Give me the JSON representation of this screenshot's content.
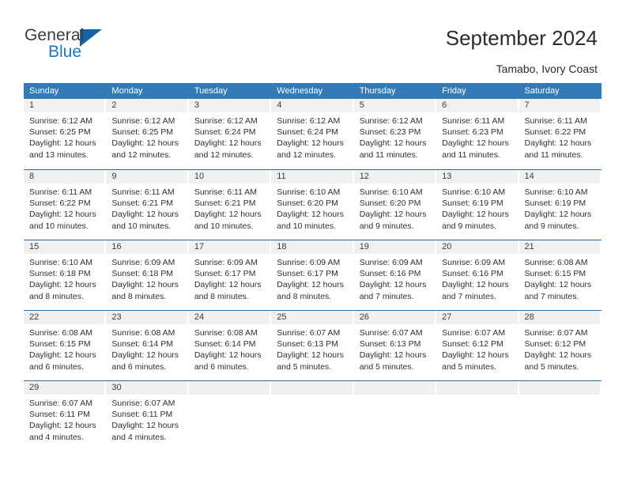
{
  "brand": {
    "name_top": "General",
    "name_bottom": "Blue",
    "color_dark": "#3b3b3b",
    "color_blue": "#1c78c0",
    "triangle_color": "#1464a5"
  },
  "header": {
    "title": "September 2024",
    "subtitle": "Tamabo, Ivory Coast"
  },
  "theme": {
    "header_bar": "#337ab7",
    "row_divider": "#2f6fa8",
    "day_head_bg": "#f0f0f0",
    "text": "#2f2f2f"
  },
  "weekdays": [
    "Sunday",
    "Monday",
    "Tuesday",
    "Wednesday",
    "Thursday",
    "Friday",
    "Saturday"
  ],
  "weeks": [
    [
      {
        "day": "1",
        "sunrise": "Sunrise: 6:12 AM",
        "sunset": "Sunset: 6:25 PM",
        "daylight1": "Daylight: 12 hours",
        "daylight2": "and 13 minutes."
      },
      {
        "day": "2",
        "sunrise": "Sunrise: 6:12 AM",
        "sunset": "Sunset: 6:25 PM",
        "daylight1": "Daylight: 12 hours",
        "daylight2": "and 12 minutes."
      },
      {
        "day": "3",
        "sunrise": "Sunrise: 6:12 AM",
        "sunset": "Sunset: 6:24 PM",
        "daylight1": "Daylight: 12 hours",
        "daylight2": "and 12 minutes."
      },
      {
        "day": "4",
        "sunrise": "Sunrise: 6:12 AM",
        "sunset": "Sunset: 6:24 PM",
        "daylight1": "Daylight: 12 hours",
        "daylight2": "and 12 minutes."
      },
      {
        "day": "5",
        "sunrise": "Sunrise: 6:12 AM",
        "sunset": "Sunset: 6:23 PM",
        "daylight1": "Daylight: 12 hours",
        "daylight2": "and 11 minutes."
      },
      {
        "day": "6",
        "sunrise": "Sunrise: 6:11 AM",
        "sunset": "Sunset: 6:23 PM",
        "daylight1": "Daylight: 12 hours",
        "daylight2": "and 11 minutes."
      },
      {
        "day": "7",
        "sunrise": "Sunrise: 6:11 AM",
        "sunset": "Sunset: 6:22 PM",
        "daylight1": "Daylight: 12 hours",
        "daylight2": "and 11 minutes."
      }
    ],
    [
      {
        "day": "8",
        "sunrise": "Sunrise: 6:11 AM",
        "sunset": "Sunset: 6:22 PM",
        "daylight1": "Daylight: 12 hours",
        "daylight2": "and 10 minutes."
      },
      {
        "day": "9",
        "sunrise": "Sunrise: 6:11 AM",
        "sunset": "Sunset: 6:21 PM",
        "daylight1": "Daylight: 12 hours",
        "daylight2": "and 10 minutes."
      },
      {
        "day": "10",
        "sunrise": "Sunrise: 6:11 AM",
        "sunset": "Sunset: 6:21 PM",
        "daylight1": "Daylight: 12 hours",
        "daylight2": "and 10 minutes."
      },
      {
        "day": "11",
        "sunrise": "Sunrise: 6:10 AM",
        "sunset": "Sunset: 6:20 PM",
        "daylight1": "Daylight: 12 hours",
        "daylight2": "and 10 minutes."
      },
      {
        "day": "12",
        "sunrise": "Sunrise: 6:10 AM",
        "sunset": "Sunset: 6:20 PM",
        "daylight1": "Daylight: 12 hours",
        "daylight2": "and 9 minutes."
      },
      {
        "day": "13",
        "sunrise": "Sunrise: 6:10 AM",
        "sunset": "Sunset: 6:19 PM",
        "daylight1": "Daylight: 12 hours",
        "daylight2": "and 9 minutes."
      },
      {
        "day": "14",
        "sunrise": "Sunrise: 6:10 AM",
        "sunset": "Sunset: 6:19 PM",
        "daylight1": "Daylight: 12 hours",
        "daylight2": "and 9 minutes."
      }
    ],
    [
      {
        "day": "15",
        "sunrise": "Sunrise: 6:10 AM",
        "sunset": "Sunset: 6:18 PM",
        "daylight1": "Daylight: 12 hours",
        "daylight2": "and 8 minutes."
      },
      {
        "day": "16",
        "sunrise": "Sunrise: 6:09 AM",
        "sunset": "Sunset: 6:18 PM",
        "daylight1": "Daylight: 12 hours",
        "daylight2": "and 8 minutes."
      },
      {
        "day": "17",
        "sunrise": "Sunrise: 6:09 AM",
        "sunset": "Sunset: 6:17 PM",
        "daylight1": "Daylight: 12 hours",
        "daylight2": "and 8 minutes."
      },
      {
        "day": "18",
        "sunrise": "Sunrise: 6:09 AM",
        "sunset": "Sunset: 6:17 PM",
        "daylight1": "Daylight: 12 hours",
        "daylight2": "and 8 minutes."
      },
      {
        "day": "19",
        "sunrise": "Sunrise: 6:09 AM",
        "sunset": "Sunset: 6:16 PM",
        "daylight1": "Daylight: 12 hours",
        "daylight2": "and 7 minutes."
      },
      {
        "day": "20",
        "sunrise": "Sunrise: 6:09 AM",
        "sunset": "Sunset: 6:16 PM",
        "daylight1": "Daylight: 12 hours",
        "daylight2": "and 7 minutes."
      },
      {
        "day": "21",
        "sunrise": "Sunrise: 6:08 AM",
        "sunset": "Sunset: 6:15 PM",
        "daylight1": "Daylight: 12 hours",
        "daylight2": "and 7 minutes."
      }
    ],
    [
      {
        "day": "22",
        "sunrise": "Sunrise: 6:08 AM",
        "sunset": "Sunset: 6:15 PM",
        "daylight1": "Daylight: 12 hours",
        "daylight2": "and 6 minutes."
      },
      {
        "day": "23",
        "sunrise": "Sunrise: 6:08 AM",
        "sunset": "Sunset: 6:14 PM",
        "daylight1": "Daylight: 12 hours",
        "daylight2": "and 6 minutes."
      },
      {
        "day": "24",
        "sunrise": "Sunrise: 6:08 AM",
        "sunset": "Sunset: 6:14 PM",
        "daylight1": "Daylight: 12 hours",
        "daylight2": "and 6 minutes."
      },
      {
        "day": "25",
        "sunrise": "Sunrise: 6:07 AM",
        "sunset": "Sunset: 6:13 PM",
        "daylight1": "Daylight: 12 hours",
        "daylight2": "and 5 minutes."
      },
      {
        "day": "26",
        "sunrise": "Sunrise: 6:07 AM",
        "sunset": "Sunset: 6:13 PM",
        "daylight1": "Daylight: 12 hours",
        "daylight2": "and 5 minutes."
      },
      {
        "day": "27",
        "sunrise": "Sunrise: 6:07 AM",
        "sunset": "Sunset: 6:12 PM",
        "daylight1": "Daylight: 12 hours",
        "daylight2": "and 5 minutes."
      },
      {
        "day": "28",
        "sunrise": "Sunrise: 6:07 AM",
        "sunset": "Sunset: 6:12 PM",
        "daylight1": "Daylight: 12 hours",
        "daylight2": "and 5 minutes."
      }
    ],
    [
      {
        "day": "29",
        "sunrise": "Sunrise: 6:07 AM",
        "sunset": "Sunset: 6:11 PM",
        "daylight1": "Daylight: 12 hours",
        "daylight2": "and 4 minutes."
      },
      {
        "day": "30",
        "sunrise": "Sunrise: 6:07 AM",
        "sunset": "Sunset: 6:11 PM",
        "daylight1": "Daylight: 12 hours",
        "daylight2": "and 4 minutes."
      },
      {
        "day": "",
        "sunrise": "",
        "sunset": "",
        "daylight1": "",
        "daylight2": ""
      },
      {
        "day": "",
        "sunrise": "",
        "sunset": "",
        "daylight1": "",
        "daylight2": ""
      },
      {
        "day": "",
        "sunrise": "",
        "sunset": "",
        "daylight1": "",
        "daylight2": ""
      },
      {
        "day": "",
        "sunrise": "",
        "sunset": "",
        "daylight1": "",
        "daylight2": ""
      },
      {
        "day": "",
        "sunrise": "",
        "sunset": "",
        "daylight1": "",
        "daylight2": ""
      }
    ]
  ]
}
